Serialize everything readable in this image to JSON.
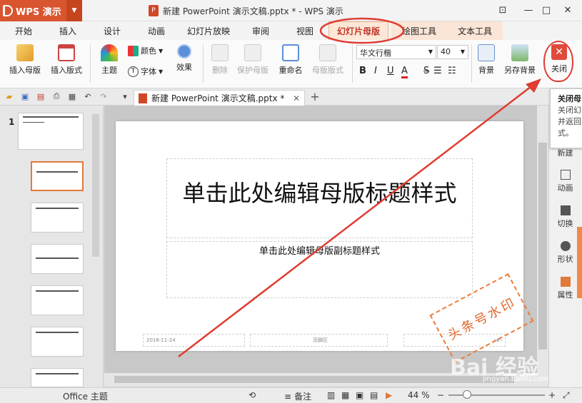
{
  "app": {
    "name": "WPS 演示"
  },
  "window": {
    "title": "新建 PowerPoint 演示文稿.pptx * - WPS 演示"
  },
  "tabs": [
    "开始",
    "插入",
    "设计",
    "动画",
    "幻灯片放映",
    "审阅",
    "视图",
    "幻灯片母版",
    "绘图工具",
    "文本工具"
  ],
  "ribbon": {
    "insert_master": "插入母版",
    "insert_layout": "插入版式",
    "theme": "主题",
    "color": "颜色",
    "font": "字体",
    "effect": "效果",
    "delete": "删除",
    "protect_master": "保护母版",
    "rename": "重命名",
    "master_layout": "母版版式",
    "font_name": "华文行楷",
    "font_size": "40",
    "bold": "B",
    "italic": "I",
    "underline": "U",
    "font_color": "A",
    "strike": "S",
    "background": "背景",
    "save_background": "另存背景",
    "close": "关闭"
  },
  "doc_tab": {
    "label": "新建 PowerPoint 演示文稿.pptx *"
  },
  "thumbnails": {
    "slide_number": "1"
  },
  "slide": {
    "title": "单击此处编辑母版标题样式",
    "subtitle": "单击此处编辑母版副标题样式",
    "date": "2018-11-24",
    "footer": "页脚区",
    "page": "‹#›"
  },
  "right_panel": {
    "new": "新建",
    "animation": "动画",
    "transition": "切换",
    "shape": "形状",
    "properties": "属性"
  },
  "tooltip": {
    "title": "关闭母",
    "line1": "关闭幻",
    "line2": "并返回",
    "line3": "式。"
  },
  "status": {
    "theme": "Office 主题",
    "notes": "备注",
    "zoom": "44 %"
  },
  "watermark": {
    "stamp": "头条号水印",
    "brand": "Bai 经验",
    "url": "jingyan.baidu.com"
  },
  "colors": {
    "accent": "#d9552f",
    "highlight": "#e03c32",
    "arrow": "#e03c32"
  }
}
